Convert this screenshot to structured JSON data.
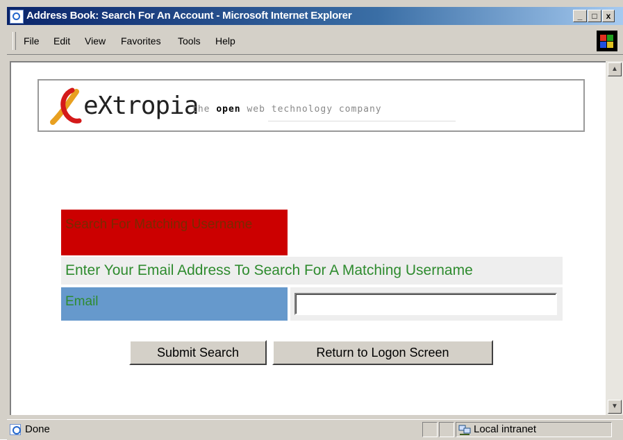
{
  "window": {
    "title": "Address Book: Search For An Account - Microsoft Internet Explorer",
    "controls": {
      "minimize": "_",
      "maximize": "□",
      "close": "x"
    }
  },
  "menu": [
    "File",
    "Edit",
    "View",
    "Favorites",
    "Tools",
    "Help"
  ],
  "logo": {
    "brand": "eXtropia",
    "tagline_pre": "the ",
    "tagline_bold": "open",
    "tagline_post": " web technology company"
  },
  "form": {
    "header": "Search For Matching Username",
    "instructions": "Enter Your Email Address To Search For A Matching Username",
    "email_label": "Email",
    "email_value": "",
    "submit_label": "Submit Search",
    "return_label": "Return to Logon Screen"
  },
  "status": {
    "text": "Done",
    "zone": "Local intranet"
  },
  "colors": {
    "header_bg": "#cc0000",
    "label_bg": "#6699cc",
    "label_text": "#2e8b2e",
    "titlebar": "#0a246a"
  }
}
